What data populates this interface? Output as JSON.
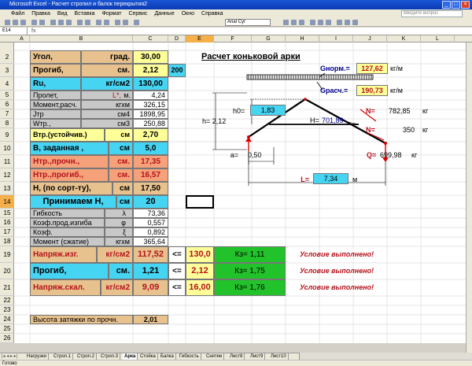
{
  "window": {
    "title": "Microsoft Excel - Расчет стропил и балок перекрытия2"
  },
  "menu": [
    "Файл",
    "Правка",
    "Вид",
    "Вставка",
    "Формат",
    "Сервис",
    "Данные",
    "Окно",
    "Справка"
  ],
  "search_placeholder": "Введите вопрос",
  "font_name": "Arial Cyr",
  "name_box": "E14",
  "columns": [
    "A",
    "B",
    "C",
    "D",
    "E",
    "F",
    "G",
    "H",
    "I",
    "J",
    "K",
    "L"
  ],
  "rows": [
    "2",
    "3",
    "4",
    "5",
    "6",
    "7",
    "8",
    "9",
    "10",
    "11",
    "12",
    "13",
    "14",
    "15",
    "16",
    "17",
    "18",
    "19",
    "20",
    "21",
    "22",
    "23",
    "24",
    "25",
    "26"
  ],
  "table": {
    "r2": {
      "label": "Угол,",
      "unit": "град.",
      "value": "30,00"
    },
    "r3": {
      "label": "Прогиб,",
      "unit": "см.",
      "value": "2,12",
      "d": "200"
    },
    "r4": {
      "label": "Ru,",
      "unit": "кг/см2",
      "value": "130,00"
    },
    "r5": {
      "label": "Пролет,",
      "unit": "L*,",
      "unit2": "м.",
      "value": "4,24"
    },
    "r6": {
      "label": "Момент,расч.",
      "unit": "кгхм",
      "value": "326,15"
    },
    "r7": {
      "label": "Jтр",
      "unit": "см4",
      "value": "1898,95"
    },
    "r8": {
      "label": "Wтр.,",
      "unit": "см3",
      "value": "250,88"
    },
    "r9": {
      "label": "Втр.(устойчив.)",
      "unit": "см",
      "value": "2,70"
    },
    "r10": {
      "label": "В, заданная ,",
      "unit": "см",
      "value": "5,0"
    },
    "r11": {
      "label": "Нтр.,прочн.,",
      "unit": "см.",
      "value": "17,35"
    },
    "r12": {
      "label": "Нтр.,прогиб.,",
      "unit": "см.",
      "value": "16,57"
    },
    "r13": {
      "label": "Н, (по сорт-ту),",
      "unit": "см",
      "value": "17,50"
    },
    "r14": {
      "label": "Принимаем Н,",
      "unit": "см",
      "value": "20"
    },
    "r15": {
      "label": "Гибкость",
      "unit": "λ",
      "value": "73,36"
    },
    "r16": {
      "label": "Коэф.прод.изгиба",
      "unit": "φ",
      "value": "0,557"
    },
    "r17": {
      "label": "Коэф.",
      "unit": "ξ",
      "value": "0,892"
    },
    "r18": {
      "label": "Момент (сжатие)",
      "unit": "кгхм",
      "value": "365,64"
    },
    "r19": {
      "label": "Напряж.изг.",
      "unit": "кг/см2",
      "value": "117,52",
      "op": "<=",
      "limit": "130,0",
      "kz": "Кз= 1,11",
      "status": "Условие выполнено!"
    },
    "r20": {
      "label": "Прогиб,",
      "unit": "см.",
      "value": "1,21",
      "op": "<=",
      "limit": "2,12",
      "kz": "Кз= 1,75",
      "status": "Условие выполнено!"
    },
    "r21": {
      "label": "Напряж.скал.",
      "unit": "кг/см2",
      "value": "9,09",
      "op": "<=",
      "limit": "16,00",
      "kz": "Кз= 1,76",
      "status": "Условие выполнено!"
    },
    "r24": {
      "label": "Высота затяжки по прочн.",
      "value": "2,01"
    }
  },
  "diagram": {
    "title": "Расчет коньковой арки",
    "qnorm_label": "Gнорм.=",
    "qnorm_value": "127,62",
    "qnorm_unit": "кг/м",
    "qcalc_label": "Gрасч.=",
    "qcalc_value": "190,73",
    "qcalc_unit": "кг/м",
    "h0_label": "h0=",
    "h0_value": "1,83",
    "h_label": "h= 2,12",
    "H_label": "H=",
    "H_value": "701,89",
    "N1_label": "N=",
    "N1_value": "782,85",
    "N1_unit": "кг",
    "N2_label": "N=",
    "N2_value": "350",
    "N2_unit": "кг",
    "a_label": "a=",
    "a_value": "0,50",
    "Q_label": "Q=",
    "Q_value": "699,98",
    "Q_unit": "кг",
    "L_label": "L=",
    "L_value": "7,34",
    "L_unit": "м"
  },
  "sheet_tabs": [
    "Нагрузки",
    "Строп.1",
    "Строп.2",
    "Строп.3",
    "Арка",
    "Стойка",
    "Балка",
    "Гибкость",
    "Снятие",
    "Лист8",
    "Лист9",
    "Лист10"
  ],
  "active_tab": "Арка",
  "status": "Готово",
  "colors": {
    "tan": "#e8c28e",
    "yellow": "#ffff99",
    "cyan": "#46d4f3",
    "pink": "#f5a17a",
    "green": "#22c22a",
    "red": "#b5121b",
    "selected": "#f5b04a"
  }
}
